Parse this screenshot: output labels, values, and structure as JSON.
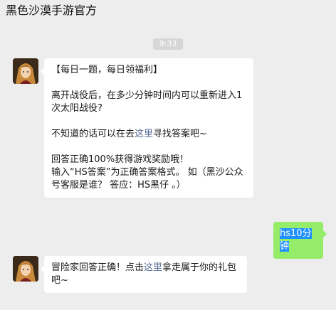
{
  "window": {
    "title": "黑色沙漠手游官方"
  },
  "chat": {
    "timestamp": "9:33",
    "messages": [
      {
        "sender": "official",
        "avatar_icon": "character-avatar-icon",
        "p1": "【每日一题，每日领福利】",
        "p2": "离开战役后，在多少分钟时间内可以重新进入1次太阳战役?",
        "p3_before": "不知道的话可以在去",
        "p3_link": "这里",
        "p3_after": "寻找答案吧~",
        "p4": "回答正确100%获得游戏奖励哦！",
        "p5": "输入“HS答案”为正确答案格式。 如（黑沙公众号客服是谁？ 答应：HS黑仔 。）"
      },
      {
        "sender": "self",
        "text": "hs10分钟"
      },
      {
        "sender": "official",
        "avatar_icon": "character-avatar-icon",
        "before": "冒险家回答正确！点击",
        "link": "这里",
        "after": "拿走属于你的礼包吧~"
      }
    ]
  },
  "colors": {
    "background": "#ededed",
    "incoming_bubble": "#ffffff",
    "outgoing_bubble": "#95ec69",
    "link": "#576b95",
    "selection": "#1e90ff"
  }
}
